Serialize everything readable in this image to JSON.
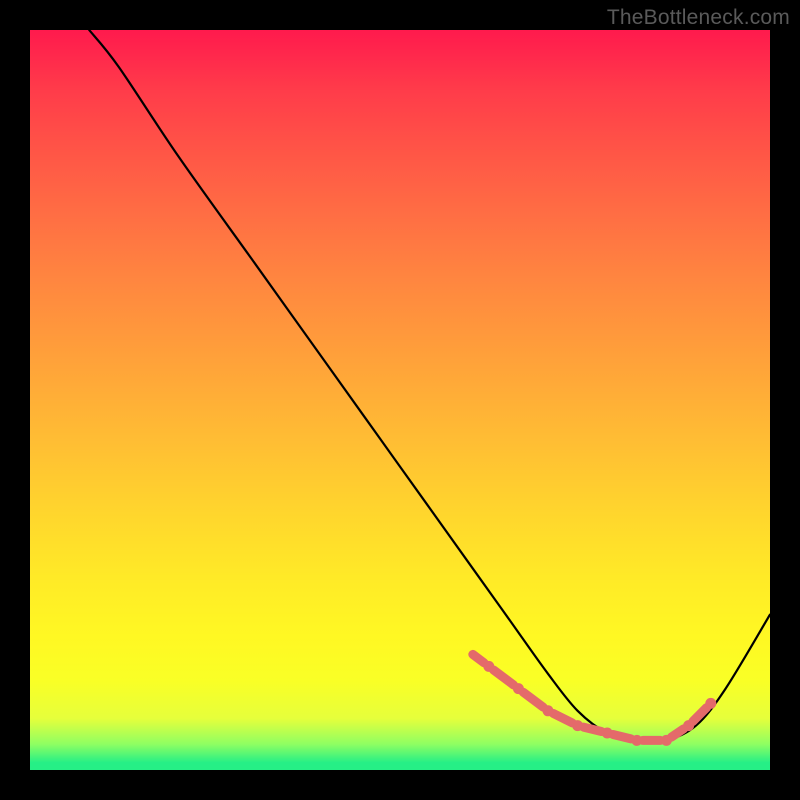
{
  "watermark": "TheBottleneck.com",
  "chart_data": {
    "type": "line",
    "title": "",
    "xlabel": "",
    "ylabel": "",
    "xlim": [
      0,
      100
    ],
    "ylim": [
      0,
      100
    ],
    "series": [
      {
        "name": "curve",
        "x": [
          8,
          12,
          20,
          30,
          40,
          50,
          60,
          65,
          70,
          74,
          78,
          82,
          86,
          90,
          94,
          100
        ],
        "values": [
          100,
          95,
          83,
          69,
          55,
          41,
          27,
          20,
          13,
          8,
          5,
          4,
          4,
          6,
          11,
          21
        ]
      }
    ],
    "highlight_region": {
      "name": "bottom-markers",
      "x": [
        62,
        66,
        70,
        74,
        78,
        82,
        86,
        89,
        92
      ],
      "values": [
        14,
        11,
        8,
        6,
        5,
        4,
        4,
        6,
        9
      ]
    },
    "gradient": {
      "top": "#ff1a4d",
      "mid": "#ffe329",
      "bottom": "#26ef86"
    }
  }
}
